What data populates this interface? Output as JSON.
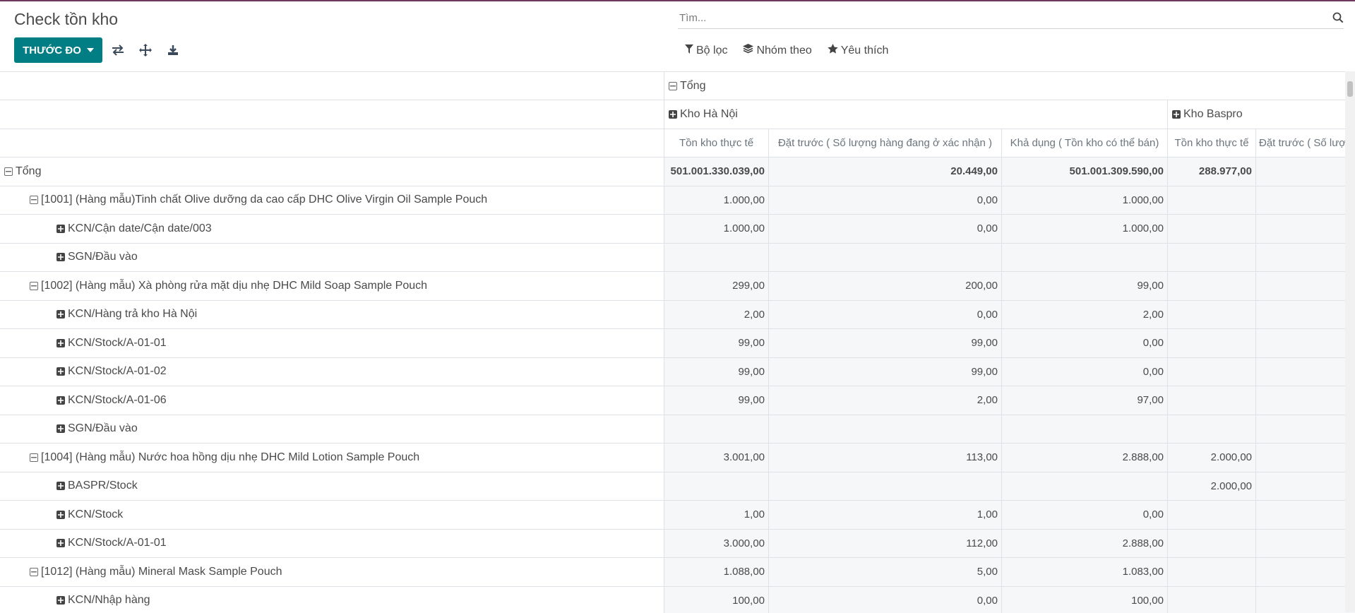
{
  "page": {
    "title": "Check tồn kho"
  },
  "toolbar": {
    "measures_label": "THƯỚC ĐO",
    "icons": [
      "flip-axis-icon",
      "expand-all-icon",
      "download-icon"
    ]
  },
  "search": {
    "placeholder": "Tìm..."
  },
  "filters": {
    "filter_label": "Bộ lọc",
    "group_label": "Nhóm theo",
    "favorite_label": "Yêu thích"
  },
  "pivot": {
    "total_header": "Tổng",
    "groups": [
      {
        "label": "Kho Hà Nội"
      },
      {
        "label": "Kho Baspro"
      }
    ],
    "measures": [
      "Tồn kho thực tế",
      "Đặt trước ( Số lượng hàng đang ở xác nhận )",
      "Khả dụng ( Tồn kho có thể bán)",
      "Tồn kho thực tế",
      "Đặt trước ( Số lượ"
    ],
    "rows": [
      {
        "label": "Tổng",
        "level": 0,
        "expanded": true,
        "bold": true,
        "values": [
          "501.001.330.039,00",
          "20.449,00",
          "501.001.309.590,00",
          "288.977,00",
          ""
        ]
      },
      {
        "label": "[1001] (Hàng mẫu)Tinh chất Olive dưỡng da cao cấp DHC Olive Virgin Oil Sample Pouch",
        "level": 1,
        "expanded": true,
        "values": [
          "1.000,00",
          "0,00",
          "1.000,00",
          "",
          ""
        ]
      },
      {
        "label": "KCN/Cận date/Cận date/003",
        "level": 2,
        "expanded": false,
        "values": [
          "1.000,00",
          "0,00",
          "1.000,00",
          "",
          ""
        ]
      },
      {
        "label": "SGN/Đầu vào",
        "level": 2,
        "expanded": false,
        "values": [
          "",
          "",
          "",
          "",
          ""
        ]
      },
      {
        "label": "[1002] (Hàng mẫu) Xà phòng rửa mặt dịu nhẹ DHC Mild Soap Sample Pouch",
        "level": 1,
        "expanded": true,
        "values": [
          "299,00",
          "200,00",
          "99,00",
          "",
          ""
        ]
      },
      {
        "label": "KCN/Hàng trả kho Hà Nội",
        "level": 2,
        "expanded": false,
        "values": [
          "2,00",
          "0,00",
          "2,00",
          "",
          ""
        ]
      },
      {
        "label": "KCN/Stock/A-01-01",
        "level": 2,
        "expanded": false,
        "values": [
          "99,00",
          "99,00",
          "0,00",
          "",
          ""
        ]
      },
      {
        "label": "KCN/Stock/A-01-02",
        "level": 2,
        "expanded": false,
        "values": [
          "99,00",
          "99,00",
          "0,00",
          "",
          ""
        ]
      },
      {
        "label": "KCN/Stock/A-01-06",
        "level": 2,
        "expanded": false,
        "values": [
          "99,00",
          "2,00",
          "97,00",
          "",
          ""
        ]
      },
      {
        "label": "SGN/Đầu vào",
        "level": 2,
        "expanded": false,
        "values": [
          "",
          "",
          "",
          "",
          ""
        ]
      },
      {
        "label": "[1004] (Hàng mẫu) Nước hoa hồng dịu nhẹ DHC Mild Lotion Sample Pouch",
        "level": 1,
        "expanded": true,
        "values": [
          "3.001,00",
          "113,00",
          "2.888,00",
          "2.000,00",
          ""
        ]
      },
      {
        "label": "BASPR/Stock",
        "level": 2,
        "expanded": false,
        "values": [
          "",
          "",
          "",
          "2.000,00",
          ""
        ]
      },
      {
        "label": "KCN/Stock",
        "level": 2,
        "expanded": false,
        "values": [
          "1,00",
          "1,00",
          "0,00",
          "",
          ""
        ]
      },
      {
        "label": "KCN/Stock/A-01-01",
        "level": 2,
        "expanded": false,
        "values": [
          "3.000,00",
          "112,00",
          "2.888,00",
          "",
          ""
        ]
      },
      {
        "label": "[1012] (Hàng mẫu) Mineral Mask Sample Pouch",
        "level": 1,
        "expanded": true,
        "values": [
          "1.088,00",
          "5,00",
          "1.083,00",
          "",
          ""
        ]
      },
      {
        "label": "KCN/Nhập hàng",
        "level": 2,
        "expanded": false,
        "values": [
          "100,00",
          "0,00",
          "100,00",
          "",
          ""
        ]
      }
    ]
  }
}
